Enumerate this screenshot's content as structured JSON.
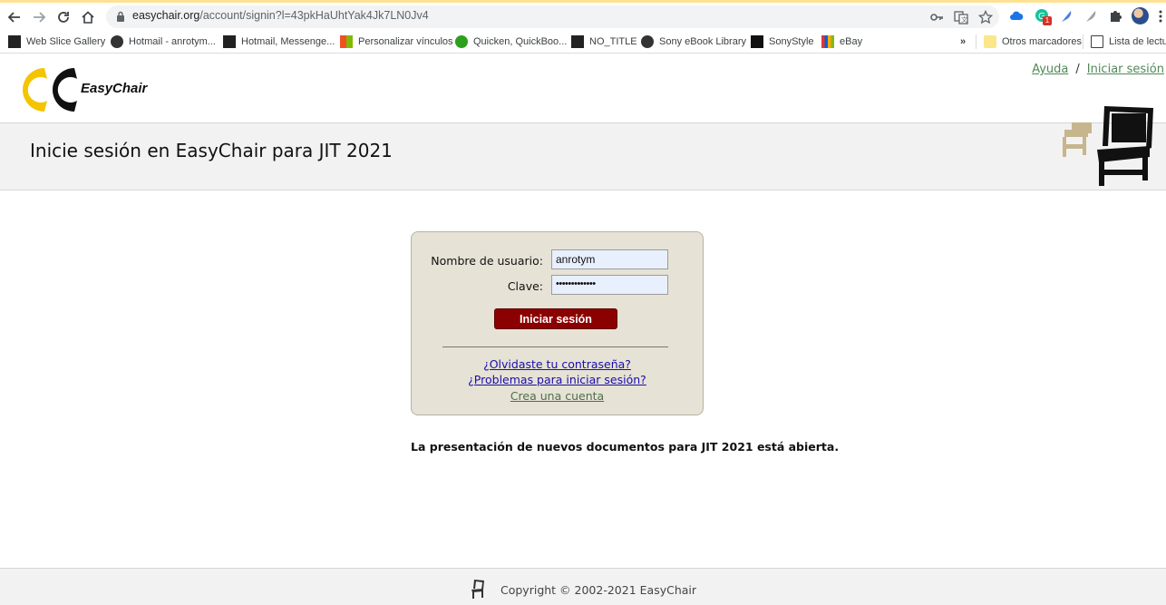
{
  "browser": {
    "url_host": "easychair.org",
    "url_path": "/account/signin?l=43pkHaUhtYak4Jk7LN0Jv4",
    "extension_badge": "1"
  },
  "bookmarks": [
    {
      "label": "Web Slice Gallery",
      "icon": "web-slice-icon"
    },
    {
      "label": "Hotmail - anrotym...",
      "icon": "globe-icon"
    },
    {
      "label": "Hotmail, Messenge...",
      "icon": "msn-icon"
    },
    {
      "label": "Personalizar vínculos",
      "icon": "windows-icon"
    },
    {
      "label": "Quicken, QuickBoo...",
      "icon": "quickbooks-icon"
    },
    {
      "label": "NO_TITLE",
      "icon": "bookmark-page-icon"
    },
    {
      "label": "Sony eBook Library",
      "icon": "globe-icon"
    },
    {
      "label": "SonyStyle",
      "icon": "sonystyle-icon"
    },
    {
      "label": "eBay",
      "icon": "ebay-icon"
    }
  ],
  "bookmarks_more": "»",
  "other_bookmarks": "Otros marcadores",
  "reading_list": "Lista de lectur",
  "header": {
    "logo_text": "EasyChair",
    "help_link": "Ayuda",
    "slash": "/",
    "signin_link": "Iniciar sesión"
  },
  "title": "Inicie sesión en EasyChair para JIT 2021",
  "form": {
    "username_label": "Nombre de usuario:",
    "username_value": "anrotym",
    "password_label": "Clave:",
    "password_value": "•••••••••••••",
    "submit_label": "Iniciar sesión",
    "forgot_link": "¿Olvidaste tu contraseña?",
    "problems_link": "¿Problemas para iniciar sesión?",
    "create_link": "Crea una cuenta"
  },
  "notice": "La presentación de nuevos documentos para JIT 2021 está abierta.",
  "footer": {
    "copyright": "Copyright © 2002-2021 EasyChair"
  },
  "colors": {
    "login_button": "#8b0000",
    "login_box": "#e6e2d6",
    "logo_yellow": "#f5c400",
    "link_green": "#4f8a57",
    "link_blue": "#1a0dab"
  }
}
